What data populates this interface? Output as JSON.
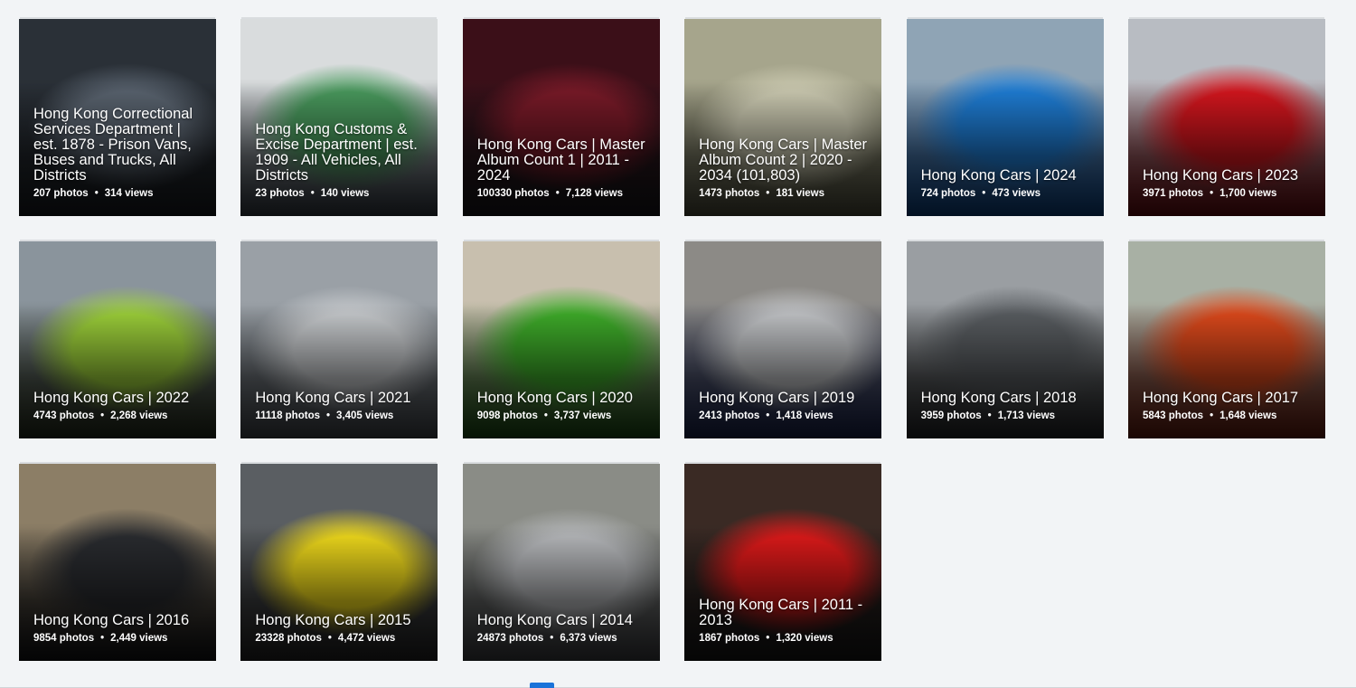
{
  "albums": [
    {
      "title": "Hong Kong Correctional Services Department | est. 1878 - Prison Vans, Buses and Trucks, All Districts",
      "photos": "207 photos",
      "views": "314 views",
      "thumb": "prison-van",
      "colors": [
        "#2a3037",
        "#5a6470",
        "#1c2025"
      ]
    },
    {
      "title": "Hong Kong Customs & Excise Department | est. 1909 - All Vehicles, All Districts",
      "photos": "23 photos",
      "views": "140 views",
      "thumb": "customs-van",
      "colors": [
        "#d9dcdd",
        "#4a9b5e",
        "#3d4650"
      ]
    },
    {
      "title": "Hong Kong Cars | Master Album Count 1 | 2011 - 2024",
      "photos": "100330 photos",
      "views": "7,128 views",
      "thumb": "pagani-dark-red",
      "colors": [
        "#3b0f18",
        "#7a1a28",
        "#1a1a1e"
      ]
    },
    {
      "title": "Hong Kong Cars | Master Album Count 2 | 2020 - 2034 (101,803)",
      "photos": "1473 photos",
      "views": "181 views",
      "thumb": "g-wagon",
      "colors": [
        "#a6a58c",
        "#cfcdb4",
        "#5c5c48"
      ]
    },
    {
      "title": "Hong Kong Cars | 2024",
      "photos": "724 photos",
      "views": "473 views",
      "thumb": "blue-ferrari",
      "colors": [
        "#8fa4b5",
        "#1f7fd8",
        "#0d4f9c"
      ]
    },
    {
      "title": "Hong Kong Cars | 2023",
      "photos": "3971 photos",
      "views": "1,700 views",
      "thumb": "red-lamborghini",
      "colors": [
        "#b8bcc2",
        "#d8161e",
        "#7a0a10"
      ]
    },
    {
      "title": "Hong Kong Cars | 2022",
      "photos": "4743 photos",
      "views": "2,268 views",
      "thumb": "lime-mclaren",
      "colors": [
        "#8a949c",
        "#9ed23a",
        "#2b3420"
      ]
    },
    {
      "title": "Hong Kong Cars | 2021",
      "photos": "11118 photos",
      "views": "3,405 views",
      "thumb": "silver-pagani",
      "colors": [
        "#9aa0a6",
        "#c9cccf",
        "#50565c"
      ]
    },
    {
      "title": "Hong Kong Cars | 2020",
      "photos": "9098 photos",
      "views": "3,737 views",
      "thumb": "green-lamborghini",
      "colors": [
        "#c8bfae",
        "#3fae2a",
        "#1d5a14"
      ]
    },
    {
      "title": "Hong Kong Cars | 2019",
      "photos": "2413 photos",
      "views": "1,418 views",
      "thumb": "silver-ferrari",
      "colors": [
        "#8c8a86",
        "#c4c6c9",
        "#1e2a5c"
      ]
    },
    {
      "title": "Hong Kong Cars | 2018",
      "photos": "3959 photos",
      "views": "1,713 views",
      "thumb": "grey-pagani",
      "colors": [
        "#9a9ea2",
        "#5a5e62",
        "#2a2c2e"
      ]
    },
    {
      "title": "Hong Kong Cars | 2017",
      "photos": "5843 photos",
      "views": "1,648 views",
      "thumb": "orange-porsche",
      "colors": [
        "#a8b0a4",
        "#e04a1c",
        "#7a2010"
      ]
    },
    {
      "title": "Hong Kong Cars | 2016",
      "photos": "9854 photos",
      "views": "2,449 views",
      "thumb": "black-pagani",
      "colors": [
        "#8c7e66",
        "#2a2c30",
        "#141518"
      ]
    },
    {
      "title": "Hong Kong Cars | 2015",
      "photos": "23328 photos",
      "views": "4,472 views",
      "thumb": "yellow-ferrari",
      "colors": [
        "#5a5e62",
        "#f2dc1c",
        "#2a2a2a"
      ]
    },
    {
      "title": "Hong Kong Cars | 2014",
      "photos": "24873 photos",
      "views": "6,373 views",
      "thumb": "silver-mclaren",
      "colors": [
        "#8a8c86",
        "#b8babd",
        "#4a4c50"
      ]
    },
    {
      "title": "Hong Kong Cars | 2011 - 2013",
      "photos": "1867 photos",
      "views": "1,320 views",
      "thumb": "red-lamborghini-rear",
      "colors": [
        "#3a2a24",
        "#e01a1a",
        "#1a1a1a"
      ]
    }
  ],
  "accent": "#1a73d9"
}
